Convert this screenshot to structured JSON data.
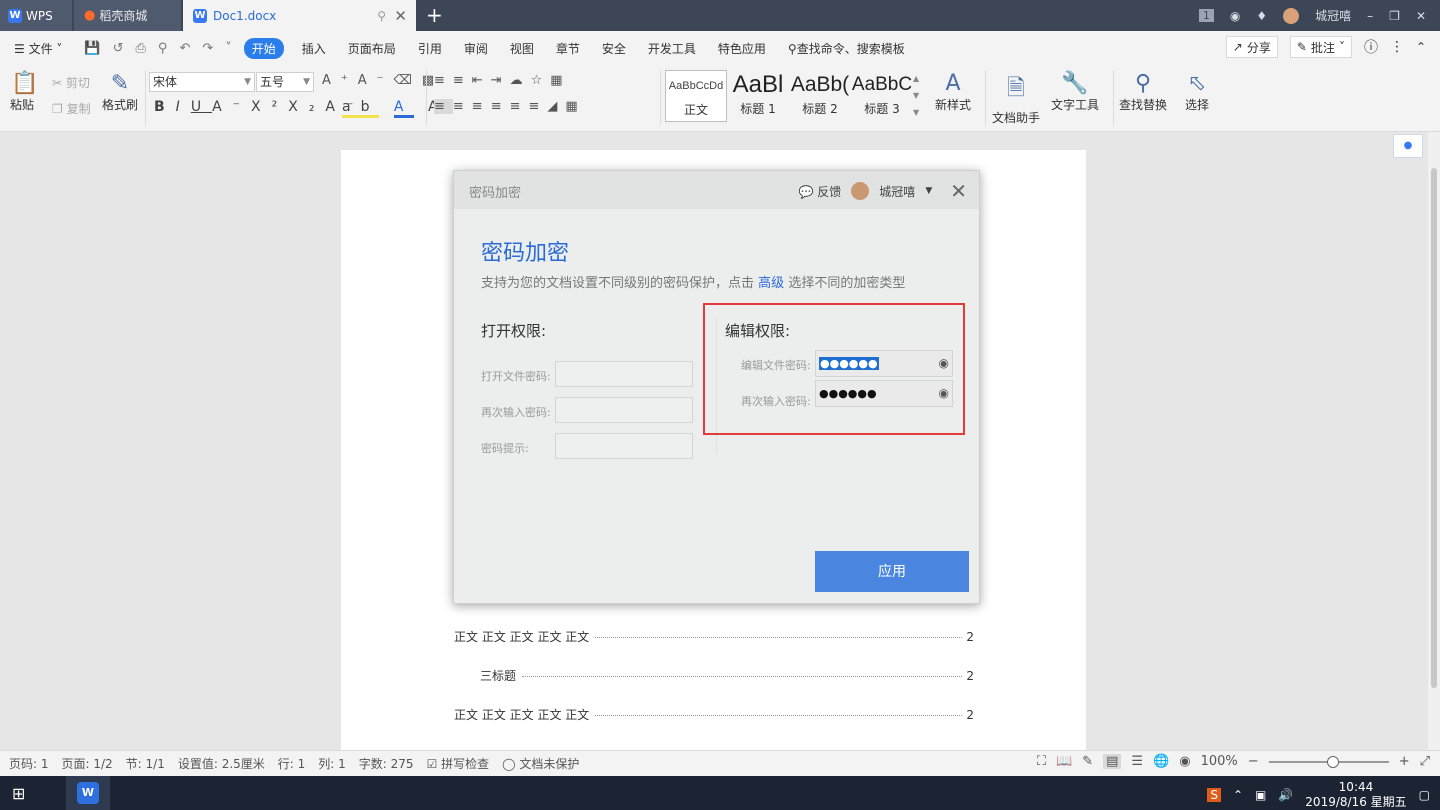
{
  "titlebar": {
    "tab_wps": "WPS",
    "tab_daoke": "稻壳商城",
    "tab_doc": "Doc1.docx",
    "new_tab": "+",
    "user": "城冠嘻",
    "badge": "1"
  },
  "menubar": {
    "file": "文件",
    "items": [
      "开始",
      "插入",
      "页面布局",
      "引用",
      "审阅",
      "视图",
      "章节",
      "安全",
      "开发工具",
      "特色应用"
    ],
    "search": "查找命令、搜索模板",
    "share": "分享",
    "comment": "批注"
  },
  "ribbon": {
    "paste": "粘贴",
    "cut": "剪切",
    "copy": "复制",
    "format_painter": "格式刷",
    "font_name": "宋体",
    "font_size": "五号",
    "styles": [
      {
        "sample": "AaBbCcDd",
        "name": "正文"
      },
      {
        "sample": "AaBl",
        "name": "标题 1"
      },
      {
        "sample": "AaBb(",
        "name": "标题 2"
      },
      {
        "sample": "AaBbC",
        "name": "标题 3"
      }
    ],
    "new_style": "新样式",
    "doc_helper": "文档助手",
    "text_tools": "文字工具",
    "find_replace": "查找替换",
    "select": "选择"
  },
  "dialog": {
    "title": "密码加密",
    "feedback": "反馈",
    "user": "城冠嘻",
    "heading": "密码加密",
    "subtitle_pre": "支持为您的文档设置不同级别的密码保护，点击",
    "subtitle_link": "高级",
    "subtitle_post": "选择不同的加密类型",
    "open_section": "打开权限:",
    "open_password_label": "打开文件密码:",
    "open_confirm_label": "再次输入密码:",
    "hint_label": "密码提示:",
    "edit_section": "编辑权限:",
    "edit_password_label": "编辑文件密码:",
    "edit_confirm_label": "再次输入密码:",
    "edit_password_value": "●●●●●●",
    "edit_confirm_value": "●●●●●●",
    "apply": "应用"
  },
  "toc": [
    {
      "text": "正文  正文  正文  正文  正文",
      "page": "2"
    },
    {
      "text": "三标题",
      "page": "2"
    },
    {
      "text": "正文  正文  正文  正文  正文",
      "page": "2"
    }
  ],
  "statusbar": {
    "page_no": "页码: 1",
    "page": "页面: 1/2",
    "section": "节: 1/1",
    "setting": "设置值: 2.5厘米",
    "row": "行: 1",
    "col": "列: 1",
    "words": "字数: 275",
    "spellcheck": "拼写检查",
    "protect": "文档未保护",
    "zoom": "100%"
  },
  "taskbar": {
    "time": "10:44",
    "date": "2019/8/16 星期五"
  },
  "colors": {
    "accent": "#2b6bd6",
    "apply_button": "#4a86e0",
    "highlight_box": "#e53a3a",
    "titlebar": "#3d4657"
  }
}
